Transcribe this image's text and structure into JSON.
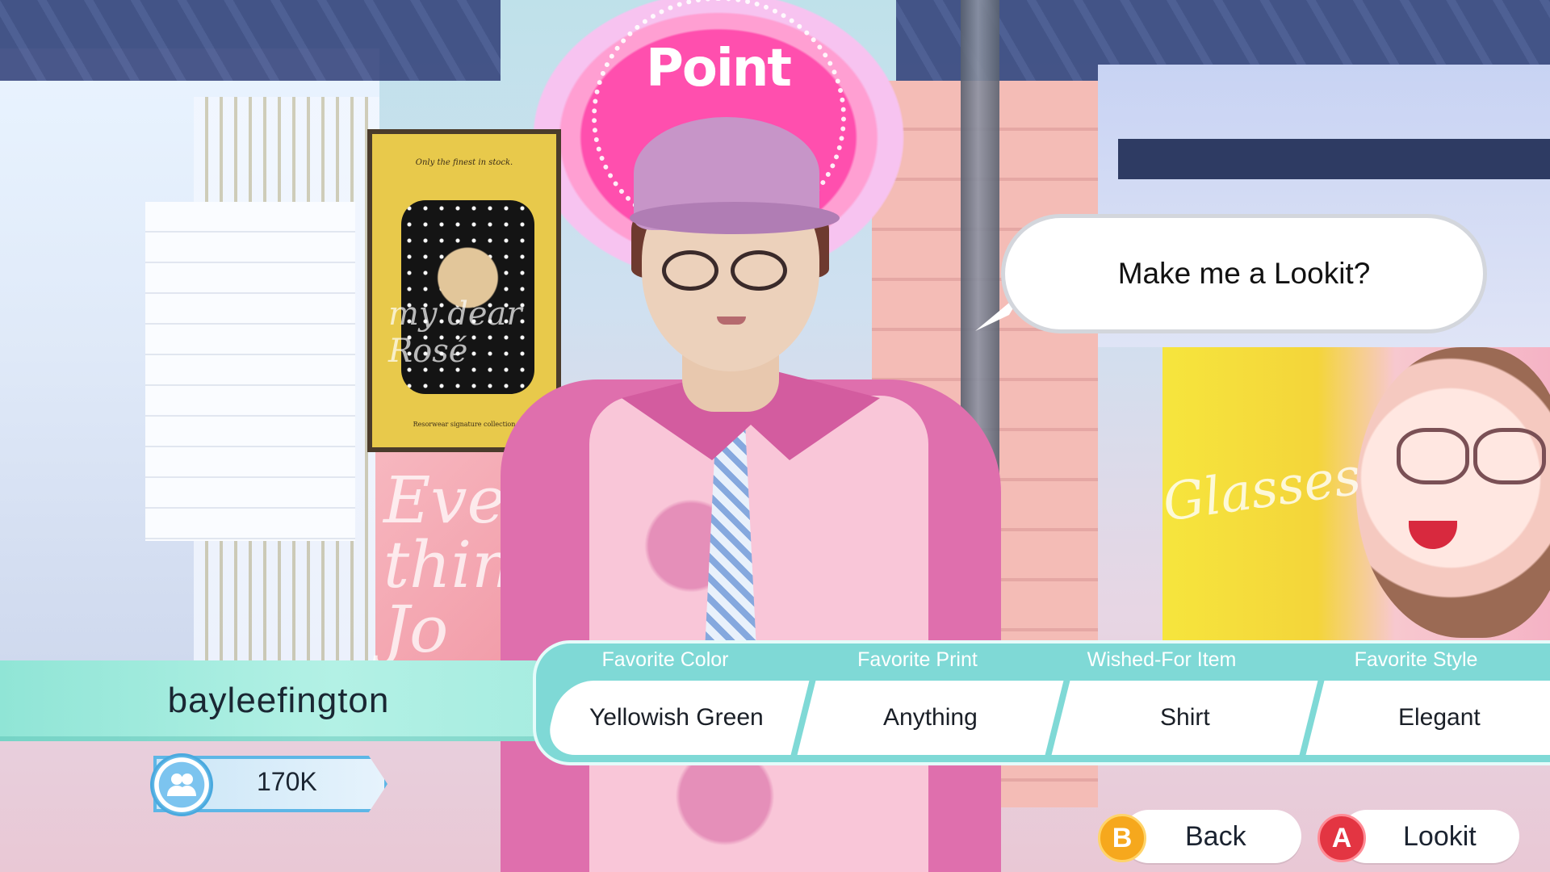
{
  "scene": {
    "sign_text": "Point",
    "poster_left": {
      "tagline": "Only the finest in stock.",
      "script": "my dear Rosé",
      "subtitle": "Resorwear signature collection"
    },
    "shoe_poster_text": "Every thing Jo",
    "glasses_ad_text": "Glasses"
  },
  "dialog": {
    "text": "Make me a Lookit?"
  },
  "customer": {
    "name": "bayleefington",
    "followers": "170K",
    "followers_icon": "followers-icon"
  },
  "preferences": {
    "items": [
      {
        "label": "Favorite Color",
        "value": "Yellowish Green"
      },
      {
        "label": "Favorite Print",
        "value": "Anything"
      },
      {
        "label": "Wished-For Item",
        "value": "Shirt"
      },
      {
        "label": "Favorite Style",
        "value": "Elegant"
      }
    ]
  },
  "controls": {
    "back": {
      "key": "B",
      "label": "Back",
      "color": "#f6a81d"
    },
    "lookit": {
      "key": "A",
      "label": "Lookit",
      "color": "#e33542"
    }
  },
  "colors": {
    "panel_teal": "#7fd9d6",
    "nameplate_mint": "#b3f1e5",
    "sign_pink": "#ff4fae"
  }
}
